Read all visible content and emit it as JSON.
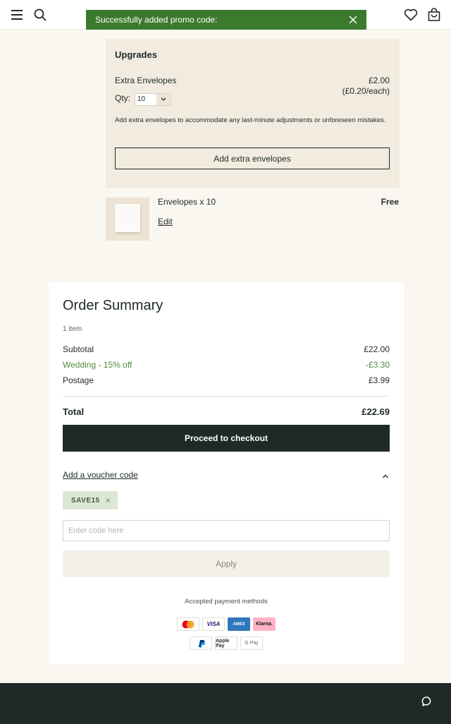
{
  "header": {
    "icons": [
      "menu-icon",
      "search-icon",
      "heart-icon",
      "bag-icon"
    ]
  },
  "toast": {
    "message": "Successfully added promo code:",
    "color": "#3b7a2c"
  },
  "upgrades": {
    "title": "Upgrades",
    "item_name": "Extra Envelopes",
    "price": "£2.00",
    "price_each": "(£0.20/each)",
    "qty_label": "Qty:",
    "qty_value": "10",
    "description": "Add extra envelopes to accommodate any last-minute adjustments or unforeseen mistakes.",
    "button_label": "Add extra envelopes"
  },
  "product": {
    "name": "Envelopes x 10",
    "price": "Free",
    "edit_label": "Edit"
  },
  "summary": {
    "title": "Order Summary",
    "item_count": "1 item",
    "subtotal_label": "Subtotal",
    "subtotal_value": "£22.00",
    "discount_label": "Wedding - 15% off",
    "discount_value": "-£3.30",
    "postage_label": "Postage",
    "postage_value": "£3.99",
    "total_label": "Total",
    "total_value": "£22.69",
    "checkout_label": "Proceed to checkout",
    "voucher_link": "Add a voucher code",
    "applied_code": "SAVE15",
    "applied_code_remove": "×",
    "code_placeholder": "Enter code here",
    "apply_label": "Apply",
    "payment_title": "Accepted payment methods",
    "payment_methods_row1": [
      "Mastercard",
      "VISA",
      "AMEX",
      "Klarna."
    ],
    "payment_methods_row2": [
      "PayPal",
      "Apple Pay",
      "G Pay"
    ]
  },
  "colors": {
    "background": "#faf6f0",
    "dark": "#1f2a28",
    "discount": "#4f8a3d",
    "upgrades_bg": "#f2ebdf"
  }
}
